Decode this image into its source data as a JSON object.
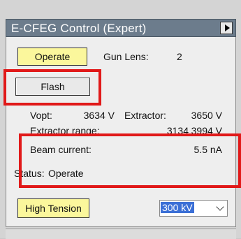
{
  "panel": {
    "title": "E-CFEG Control (Expert)"
  },
  "buttons": {
    "operate": "Operate",
    "flash": "Flash",
    "high_tension": "High Tension"
  },
  "gun_lens": {
    "label": "Gun Lens:",
    "value": "2"
  },
  "vopt": {
    "label": "Vopt:",
    "value": "3634 V"
  },
  "extractor": {
    "label": "Extractor:",
    "value": "3650 V"
  },
  "extractor_range": {
    "label": "Extractor range:",
    "min": "3134",
    "max": "3994 V"
  },
  "beam_current": {
    "label": "Beam current:",
    "value": "5.5 nA"
  },
  "status": {
    "label": "Status:",
    "value": "Operate"
  },
  "high_tension_select": {
    "selected": "300 kV"
  },
  "colors": {
    "highlight": "#e11919",
    "button_yellow": "#fbf79c",
    "header": "#6c7c8c",
    "selection": "#3b6fd6"
  }
}
